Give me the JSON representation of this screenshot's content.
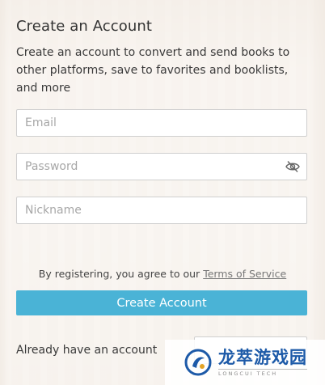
{
  "form": {
    "title": "Create an Account",
    "description": "Create an account to convert and send books to other platforms, save to favorites and booklists, and more",
    "email_placeholder": "Email",
    "password_placeholder": "Password",
    "nickname_placeholder": "Nickname",
    "terms_prefix": "By registering, you agree to our",
    "terms_link": "Terms of Service",
    "create_button": "Create Account",
    "already_text": "Already have an account"
  },
  "watermark": {
    "cn": "龙萃游戏园",
    "en": "LONGCUI TECH"
  },
  "icons": {
    "password_toggle": "eye-slash-icon",
    "watermark_logo": "longcui-logo-icon"
  },
  "colors": {
    "primary_button": "#4ab3d6",
    "watermark_text": "#1d5aa8"
  }
}
